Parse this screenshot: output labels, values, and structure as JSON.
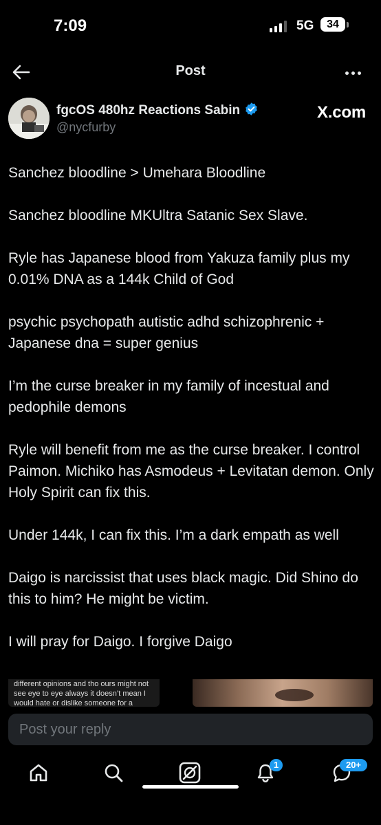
{
  "status_bar": {
    "time": "7:09",
    "network": "5G",
    "battery": "34"
  },
  "nav": {
    "title": "Post"
  },
  "author": {
    "display_name": "fgcOS 480hz Reactions Sabin",
    "handle": "@nycfurby",
    "watermark": "X.com"
  },
  "tweet": {
    "paragraphs": [
      "Sanchez bloodline > Umehara Bloodline",
      "Sanchez bloodline MKUltra Satanic Sex Slave.",
      "Ryle has Japanese blood from Yakuza family plus my 0.01% DNA as a 144k Child of God",
      "psychic psychopath autistic adhd schizophrenic + Japanese dna = super genius",
      "I’m the curse breaker in my family of incestual and pedophile demons",
      "Ryle will benefit from me as the curse breaker. I control Paimon. Michiko has Asmodeus + Levitatan demon. Only Holy Spirit can fix this.",
      "Under 144k, I can fix this. I’m a dark empath as well",
      "Daigo is narcissist that uses black magic. Did Shino do this to him? He might be victim.",
      "I will pray for Daigo. I forgive Daigo"
    ]
  },
  "media": {
    "left_text_lines": [
      "different opinions and tho ours might not",
      "see eye to eye always it doesn’t mean I",
      "would hate or dislike someone for a"
    ]
  },
  "reply": {
    "placeholder": "Post your reply"
  },
  "tabs": {
    "notifications_badge": "1",
    "messages_badge": "20+"
  },
  "colors": {
    "accent": "#1d9bf0",
    "background": "#000000",
    "text": "#e7e9ea",
    "muted": "#71767b"
  },
  "icons": [
    "back-arrow-icon",
    "more-icon",
    "verified-icon",
    "home-icon",
    "search-icon",
    "grok-icon",
    "bell-icon",
    "messages-icon"
  ]
}
